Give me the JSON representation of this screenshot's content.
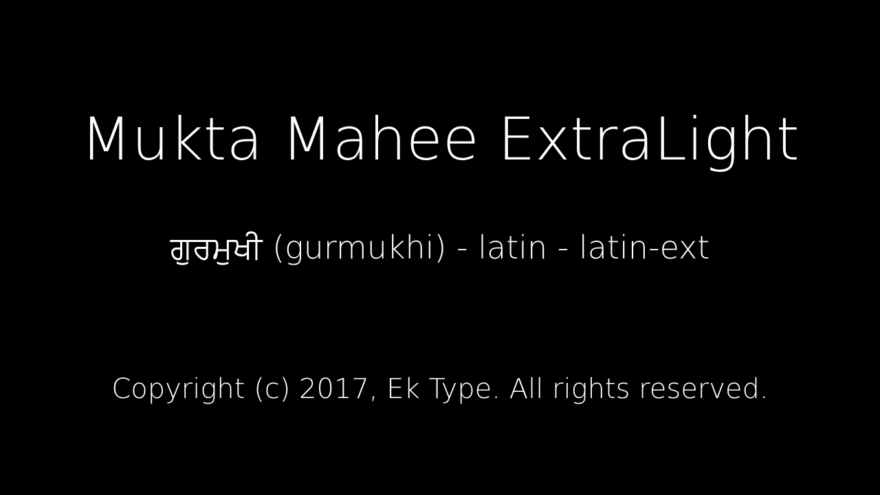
{
  "sample": {
    "font_name": "Mukta Mahee ExtraLight",
    "scripts_line": "ਗੁਰਮੁਖੀ (gurmukhi) - latin - latin-ext",
    "copyright": "Copyright (c) 2017, Ek Type. All rights reserved."
  },
  "colors": {
    "background": "#000000",
    "text": "#ffffff"
  }
}
